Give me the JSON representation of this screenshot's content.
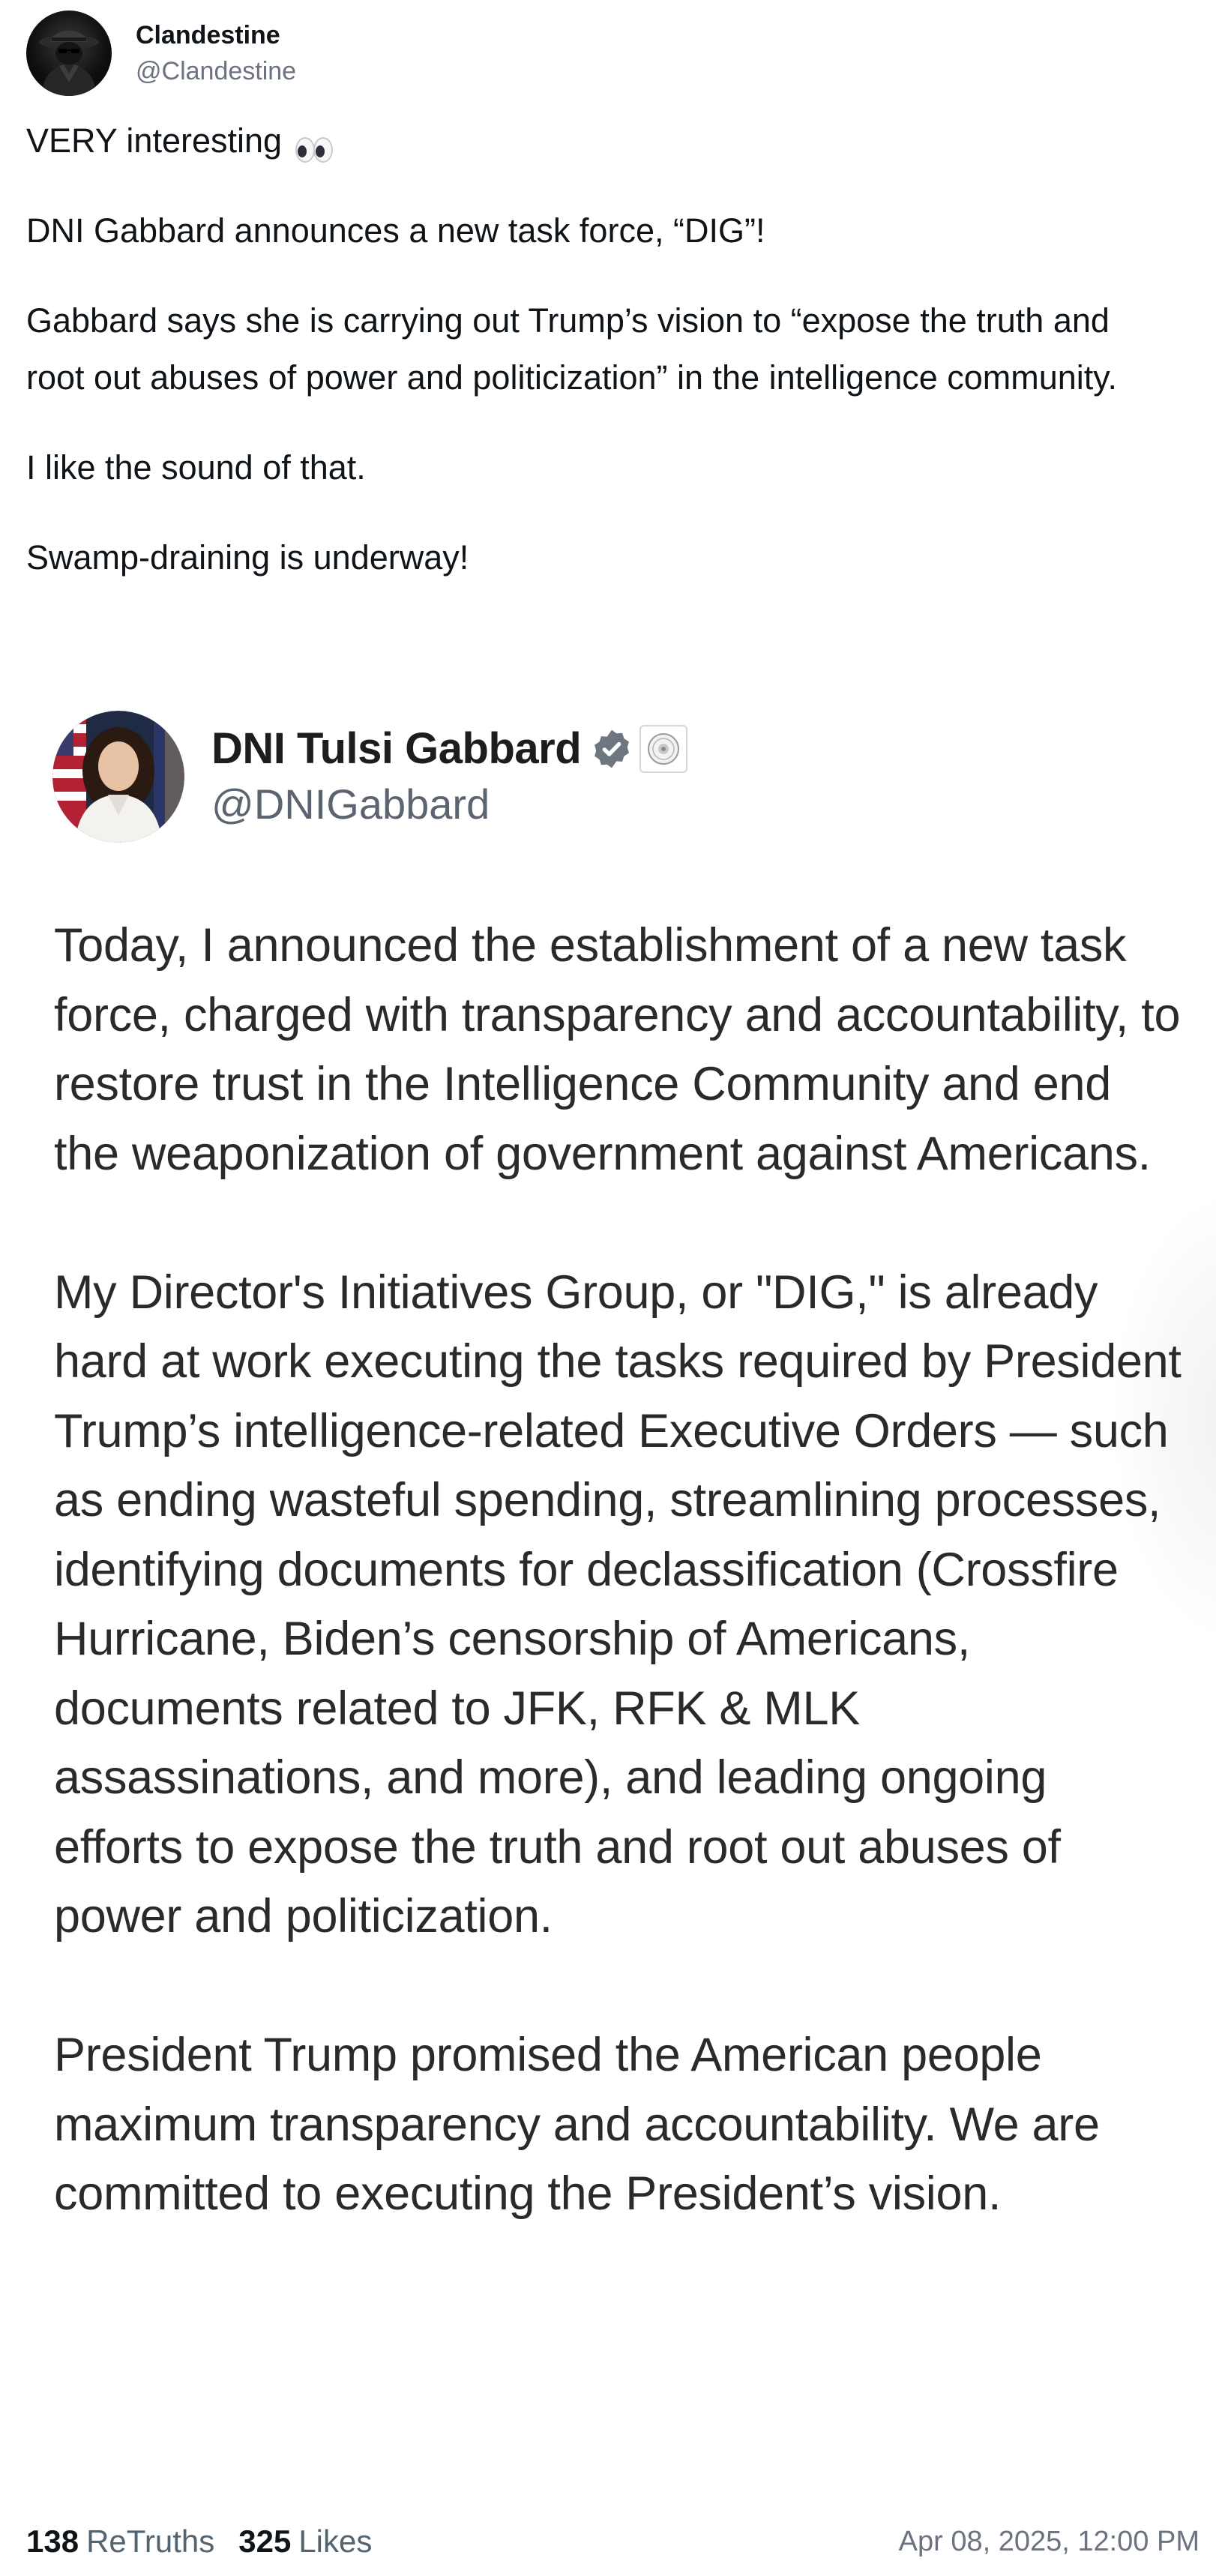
{
  "author": {
    "display_name": "Clandestine",
    "handle": "@Clandestine"
  },
  "post": {
    "paragraphs": [
      "VERY interesting",
      "DNI Gabbard announces a new task force, “DIG”!",
      "Gabbard says she is carrying out Trump’s vision to “expose the truth and root out abuses of power and politicization” in the intelligence community.",
      "I like the sound of that.",
      "Swamp-draining is underway!"
    ],
    "emoji_icon": "eyes-icon"
  },
  "embedded_post": {
    "display_name": "DNI Tulsi Gabbard",
    "handle": "@DNIGabbard",
    "verified_icon": "verified-badge-icon",
    "affiliation_icon": "government-seal-icon",
    "paragraphs": [
      "Today, I announced the establishment of a new task force, charged with transparency and accountability, to restore trust in the Intelligence Community and end the weaponization of government against Americans.",
      "My Director's Initiatives Group, or \"DIG,\" is already hard at work executing the tasks required by President Trump’s intelligence-related Executive Orders — such as ending wasteful spending, streamlining processes, identifying documents for declassification (Crossfire Hurricane, Biden’s censorship of Americans, documents related to JFK, RFK & MLK assassinations, and more), and leading ongoing efforts to expose the truth and root out abuses of power and politicization.",
      "President Trump promised the American people maximum transparency and accountability. We are committed to executing the President’s vision."
    ]
  },
  "stats": {
    "retruths_count": "138",
    "retruths_label": "ReTruths",
    "likes_count": "325",
    "likes_label": "Likes",
    "timestamp": "Apr 08, 2025, 12:00 PM"
  },
  "colors": {
    "text_primary": "#0f1419",
    "text_secondary": "#6b7280",
    "verified_badge": "#6e7681"
  }
}
